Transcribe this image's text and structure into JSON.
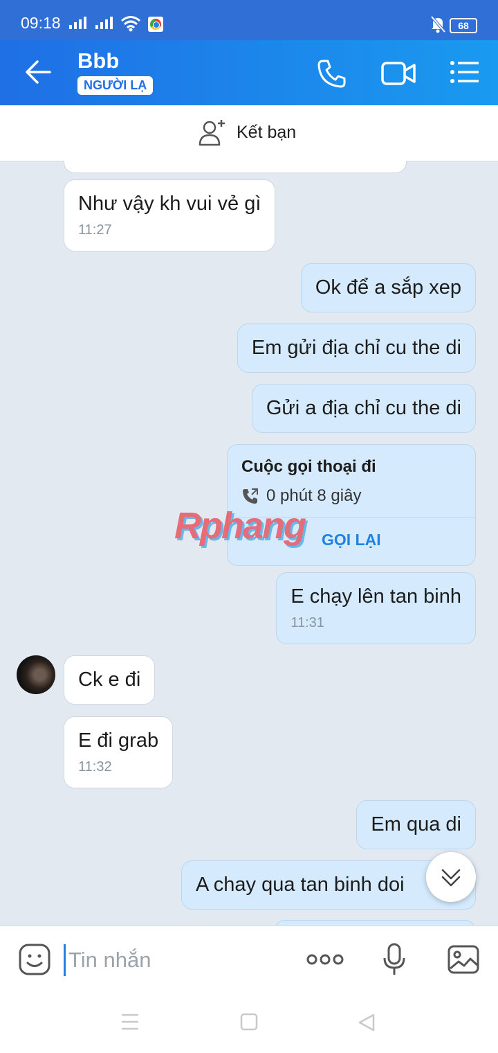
{
  "status_bar": {
    "time": "09:18",
    "battery": "68"
  },
  "header": {
    "title": "Bbb",
    "badge": "NGƯỜI LẠ"
  },
  "friend_bar": {
    "label": "Kết bạn"
  },
  "messages": [
    {
      "text": "Như vậy kh vui vẻ gì",
      "time": "11:27"
    },
    {
      "text": "Ok để a sắp xep"
    },
    {
      "text": "Em gửi địa chỉ cu the di"
    },
    {
      "text": "Gửi a địa chỉ cu the di"
    },
    {
      "call_title": "Cuộc gọi thoại đi",
      "call_duration": "0 phút 8 giây",
      "call_action": "GỌI LẠI"
    },
    {
      "text": "E chạy lên tan binh",
      "time": "11:31"
    },
    {
      "text": "Ck e đi"
    },
    {
      "text": "E đi grab",
      "time": "11:32"
    },
    {
      "text": "Em qua di"
    },
    {
      "text": "A chay qua tan binh doi"
    }
  ],
  "watermark": "Rphang",
  "input": {
    "placeholder": "Tin nhắn"
  },
  "colors": {
    "header": "#1f6fe5",
    "outgoing_bubble": "#d5ebfd",
    "incoming_bubble": "#ffffff",
    "background": "#e2e9f1"
  }
}
